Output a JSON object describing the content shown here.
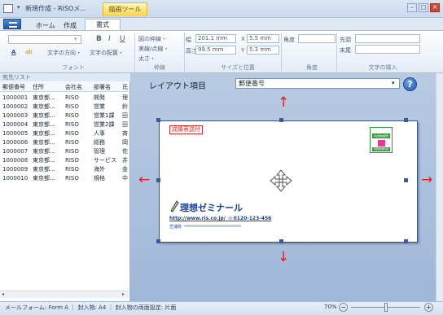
{
  "window": {
    "title": "新規作成 - RISOメ...",
    "context_tab": "描画ツール",
    "qa_arrow": "▾",
    "minimize": "–",
    "maximize": "□",
    "close": "✕"
  },
  "tabs": {
    "home": "ホーム",
    "create": "作成",
    "format": "書式"
  },
  "ribbon": {
    "font": {
      "label": "フォント",
      "bold": "B",
      "italic": "I",
      "underline": "U",
      "text_direction": "文字の方向・",
      "text_align": "文字の配置・",
      "font_color_icon": "A",
      "highlight_icon": "ab"
    },
    "border": {
      "label": "枠線",
      "outline": "図の枠線・",
      "dash": "実線/点線・",
      "weight": "太さ・"
    },
    "size_pos": {
      "label": "サイズと位置",
      "width_label": "幅",
      "width_value": "201.1 mm",
      "height_label": "高さ",
      "height_value": "99.5 mm",
      "x_label": "X",
      "x_value": "5.5 mm",
      "y_label": "Y",
      "y_value": "5.3 mm"
    },
    "angle": {
      "label": "角度",
      "field_label": "角度"
    },
    "insert_text": {
      "label": "文字の挿入",
      "start_label": "先頭",
      "end_label": "末尾"
    }
  },
  "list_panel": {
    "title": "宛先リスト",
    "columns": [
      "郵便番号",
      "住所",
      "会社名",
      "部署名",
      "氏"
    ],
    "rows": [
      [
        "1000001",
        "東京都...",
        "RISO",
        "開発",
        "理"
      ],
      [
        "1000002",
        "東京都...",
        "RISO",
        "営業",
        "鈴"
      ],
      [
        "1000003",
        "東京都...",
        "RISO",
        "営業1課",
        "田"
      ],
      [
        "1000004",
        "東京都...",
        "RISO",
        "営業2課",
        "田"
      ],
      [
        "1000005",
        "東京都...",
        "RISO",
        "人事",
        "斉"
      ],
      [
        "1000006",
        "東京都...",
        "RISO",
        "総務",
        "岡"
      ],
      [
        "1000007",
        "東京都...",
        "RISO",
        "管理",
        "佐"
      ],
      [
        "1000008",
        "東京都...",
        "RISO",
        "サービス",
        "井"
      ],
      [
        "1000009",
        "東京都...",
        "RISO",
        "海外",
        "金"
      ],
      [
        "1000010",
        "東京都...",
        "RISO",
        "規格",
        "中"
      ]
    ]
  },
  "canvas": {
    "layout_label": "レイアウト項目",
    "layout_value": "郵便番号",
    "help": "?"
  },
  "card": {
    "stamp_text": "成績表送付",
    "postage_top": "料金後納郵便",
    "postage_bottom": "特別郵便料金",
    "brand": "理想ゼミナール",
    "url_line": "http://www.ris.co.jp/ ☏0120-123-456",
    "branch": "芝浦校"
  },
  "status": {
    "text": "メールフォーム: Form A ｜ 封入物: A4 ｜ 封入物の両面設定: 片面",
    "zoom": "70%",
    "zoom_minus": "−",
    "zoom_plus": "+",
    "zoom_level": 0.5
  },
  "colors": {
    "arrow": "#e02020",
    "accent": "#1e56b0",
    "stamp_red": "#d82a2a",
    "brand_blue": "#1a3f9e",
    "postage_green": "#2f9a3a"
  }
}
